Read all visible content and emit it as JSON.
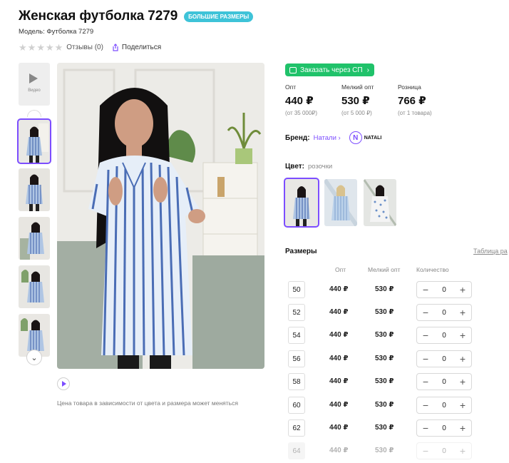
{
  "product": {
    "title": "Женская футболка 7279",
    "badge": "БОЛЬШИЕ РАЗМЕРЫ",
    "model": "Модель: Футболка 7279",
    "reviews": "Отзывы (0)",
    "share": "Поделиться",
    "rating_stars": 0
  },
  "gallery": {
    "video_label": "Видео",
    "note": "Цена товара в зависимости от цвета и размера может меняться"
  },
  "order": {
    "sp_button": "Заказать через СП"
  },
  "prices": [
    {
      "label": "Опт",
      "value": "440 ₽",
      "sub": "(от 35 000₽)"
    },
    {
      "label": "Мелкий опт",
      "value": "530 ₽",
      "sub": "(от 5 000 ₽)"
    },
    {
      "label": "Розница",
      "value": "766 ₽",
      "sub": "(от 1 товара)"
    }
  ],
  "brand": {
    "label": "Бренд:",
    "link": "Натали",
    "logo_letter": "N",
    "logo_name": "NATALI"
  },
  "color": {
    "label": "Цвет:",
    "value": "розочки"
  },
  "sizes": {
    "header": "Размеры",
    "table_link": "Таблица ра",
    "col_opt": "Опт",
    "col_small": "Мелкий опт",
    "col_qty": "Количество",
    "rows": [
      {
        "size": "50",
        "opt": "440 ₽",
        "small": "530 ₽",
        "qty": "0"
      },
      {
        "size": "52",
        "opt": "440 ₽",
        "small": "530 ₽",
        "qty": "0"
      },
      {
        "size": "54",
        "opt": "440 ₽",
        "small": "530 ₽",
        "qty": "0"
      },
      {
        "size": "56",
        "opt": "440 ₽",
        "small": "530 ₽",
        "qty": "0"
      },
      {
        "size": "58",
        "opt": "440 ₽",
        "small": "530 ₽",
        "qty": "0"
      },
      {
        "size": "60",
        "opt": "440 ₽",
        "small": "530 ₽",
        "qty": "0"
      },
      {
        "size": "62",
        "opt": "440 ₽",
        "small": "530 ₽",
        "qty": "0"
      },
      {
        "size": "64",
        "opt": "440 ₽",
        "small": "530 ₽",
        "qty": "0"
      }
    ]
  },
  "icons": {
    "minus": "−",
    "plus": "+"
  },
  "colors": {
    "accent": "#7c4dff",
    "green": "#20c26a",
    "badge": "#3ec3d8"
  }
}
